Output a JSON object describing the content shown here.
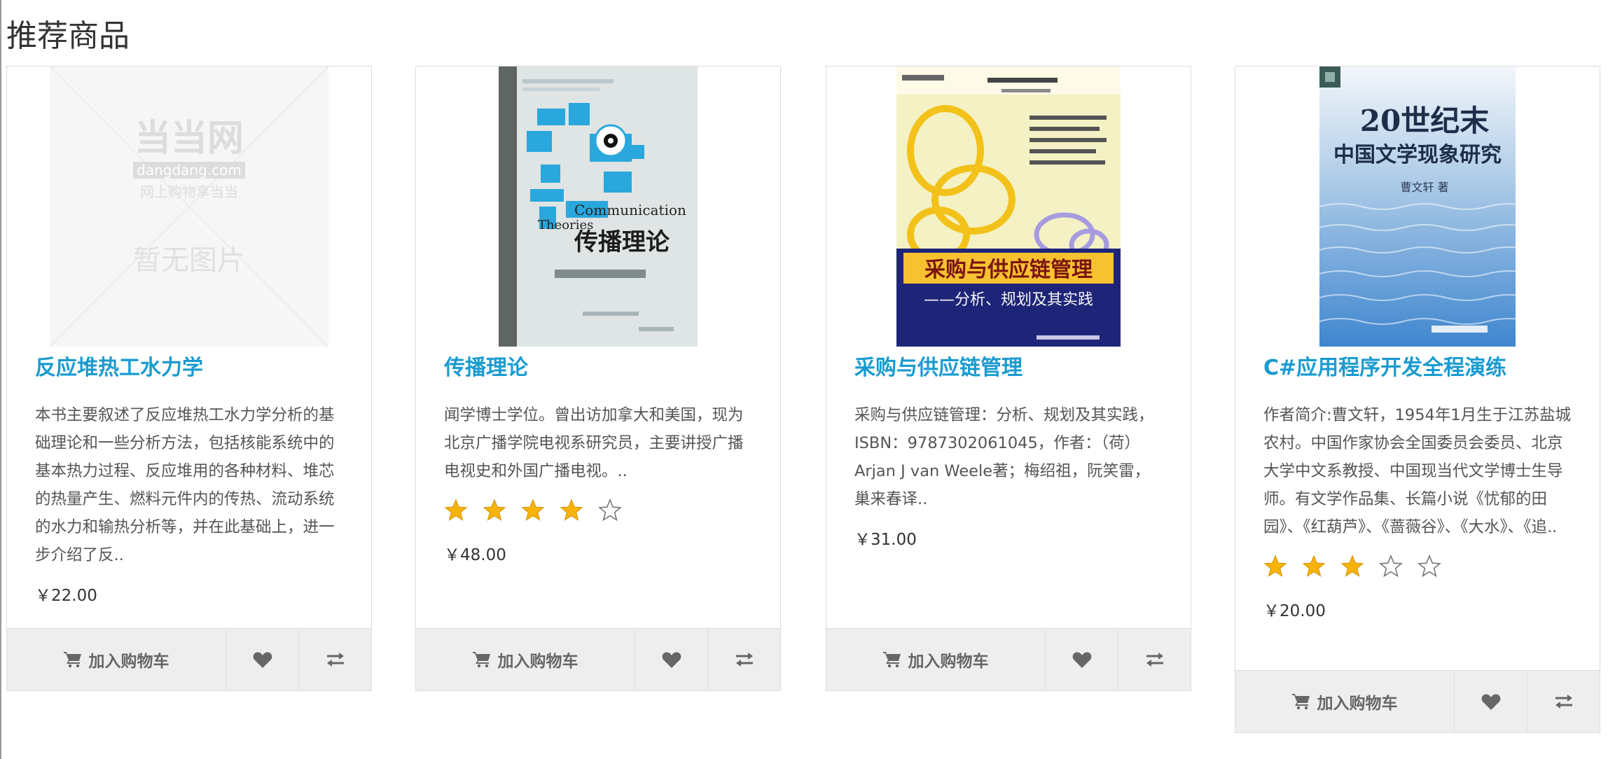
{
  "section": {
    "title": "推荐商品"
  },
  "colors": {
    "title_link": "#1a9bd0",
    "star_filled": "#f6b30c",
    "action_bg": "#eeeeee",
    "border": "#dddddd"
  },
  "placeholder_image": {
    "brand": "当当网",
    "domain": "dangdang.com",
    "slogan": "网上购物享当当",
    "no_image": "暂无图片"
  },
  "book_covers": {
    "comm": {
      "en_line1": "Communication",
      "en_line2": "Theories",
      "zh_title": "传播理论"
    },
    "procure": {
      "title": "采购与供应链管理",
      "subtitle": "——分析、规划及其实践"
    },
    "lit": {
      "line1": "20世纪末",
      "line2": "中国文学现象研究",
      "author": "曹文轩 著"
    }
  },
  "products": [
    {
      "title": "反应堆热工水力学",
      "desc": "本书主要叙述了反应堆热工水力学分析的基础理论和一些分析方法，包括核能系统中的基本热力过程、反应堆用的各种材料、堆芯的热量产生、燃料元件内的传热、流动系统的水力和输热分析等，并在此基础上，进一步介绍了反..",
      "rating": 0,
      "price": "￥22.00",
      "cover_icon": "placeholder-image-icon"
    },
    {
      "title": "传播理论",
      "desc": "闻学博士学位。曾出访加拿大和美国，现为北京广播学院电视系研究员，主要讲授广播电视史和外国广播电视。..",
      "rating": 4,
      "price": "￥48.00",
      "cover_icon": "book-cover-communication-theories"
    },
    {
      "title": "采购与供应链管理",
      "desc": "采购与供应链管理：分析、规划及其实践，ISBN：9787302061045，作者：（荷）Arjan J van Weele著；梅绍祖，阮笑雷，巢来春译..",
      "rating": 0,
      "price": "￥31.00",
      "cover_icon": "book-cover-procurement"
    },
    {
      "title": "C#应用程序开发全程演练",
      "desc": "作者简介:曹文轩，1954年1月生于江苏盐城农村。中国作家协会全国委员会委员、北京大学中文系教授、中国现当代文学博士生导师。有文学作品集、长篇小说《忧郁的田园》、《红葫芦》、《蔷薇谷》、《大水》、《追..",
      "rating": 3,
      "price": "￥20.00",
      "cover_icon": "book-cover-literature"
    }
  ],
  "actions": {
    "add_to_cart": "加入购物车",
    "cart_icon": "shopping-cart-icon",
    "wishlist_icon": "heart-icon",
    "compare_icon": "exchange-arrows-icon"
  },
  "rating_max": 5
}
